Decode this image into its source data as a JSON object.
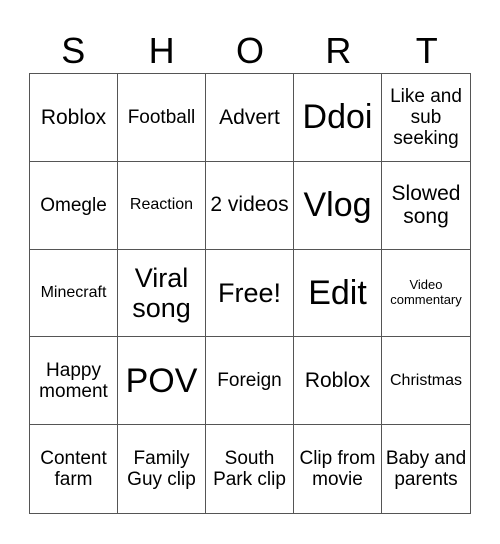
{
  "title_letters": [
    "S",
    "H",
    "O",
    "R",
    "T"
  ],
  "cells": [
    "Roblox",
    "Football",
    "Advert",
    "Ddoi",
    "Like and sub seeking",
    "Omegle",
    "Reaction",
    "2 videos",
    "Vlog",
    "Slowed song",
    "Minecraft",
    "Viral song",
    "Free!",
    "Edit",
    "Video commentary",
    "Happy moment",
    "POV",
    "Foreign",
    "Roblox",
    "Christmas",
    "Content farm",
    "Family Guy clip",
    "South Park clip",
    "Clip from movie",
    "Baby and parents"
  ],
  "colors": {
    "text": "#000000",
    "grid_line": "#555555",
    "background": "#ffffff"
  }
}
